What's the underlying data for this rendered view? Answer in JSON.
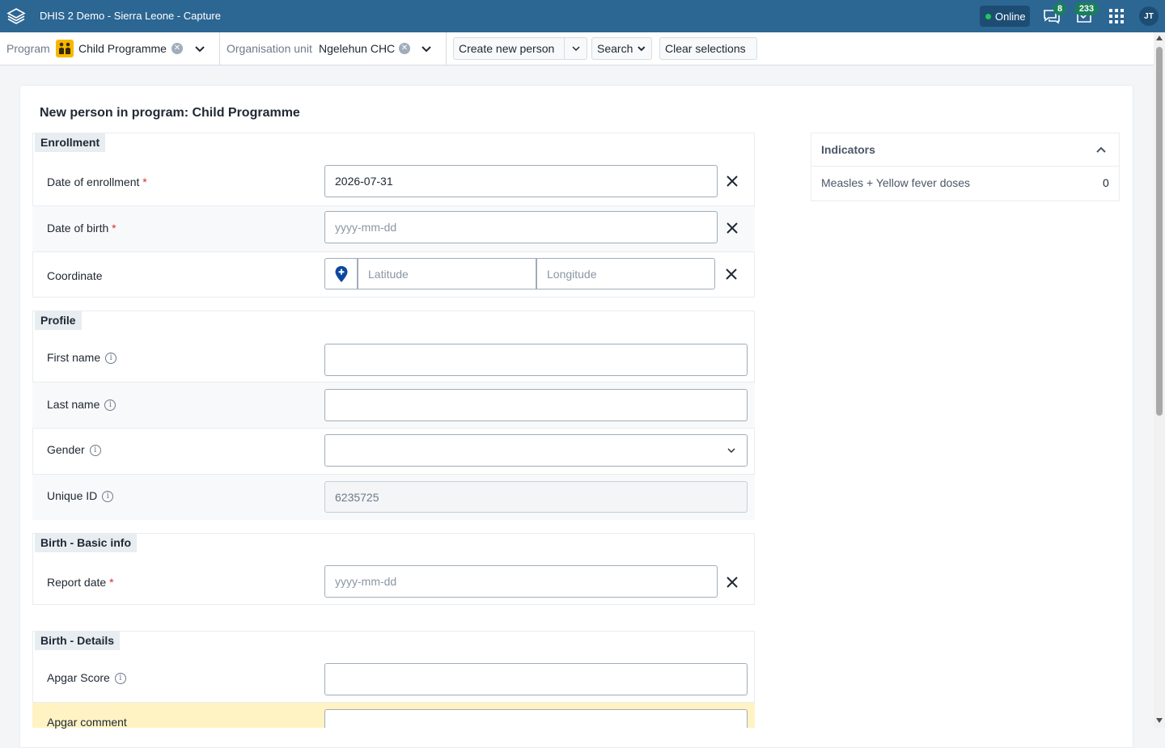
{
  "header": {
    "title": "DHIS 2 Demo - Sierra Leone - Capture",
    "status": "Online",
    "messages_count": "8",
    "interpretations_count": "233",
    "user_initials": "JT"
  },
  "topbar": {
    "program_label": "Program",
    "program_value": "Child Programme",
    "orgunit_label": "Organisation unit",
    "orgunit_value": "Ngelehun CHC",
    "create_new_label": "Create new person",
    "search_label": "Search",
    "clear_selections_label": "Clear selections"
  },
  "form": {
    "title": "New person in program: Child Programme",
    "sections": {
      "enrollment": {
        "title": "Enrollment",
        "date_of_enrollment_label": "Date of enrollment",
        "date_of_enrollment_value": "2026-07-31",
        "date_of_birth_label": "Date of birth",
        "date_of_birth_placeholder": "yyyy-mm-dd",
        "coordinate_label": "Coordinate",
        "latitude_placeholder": "Latitude",
        "longitude_placeholder": "Longitude"
      },
      "profile": {
        "title": "Profile",
        "first_name_label": "First name",
        "last_name_label": "Last name",
        "gender_label": "Gender",
        "unique_id_label": "Unique ID",
        "unique_id_value": "6235725"
      },
      "birth_basic": {
        "title": "Birth - Basic info",
        "report_date_label": "Report date",
        "report_date_placeholder": "yyyy-mm-dd"
      },
      "birth_details": {
        "title": "Birth - Details",
        "apgar_score_label": "Apgar Score",
        "apgar_comment_label": "Apgar comment"
      }
    },
    "required_marker": "*"
  },
  "indicators": {
    "title": "Indicators",
    "items": [
      {
        "label": "Measles + Yellow fever doses",
        "value": "0"
      }
    ]
  },
  "colors": {
    "header_bg": "#2c6693",
    "badge_green": "#1a7f5a",
    "required_red": "#d32f2f",
    "highlight_row": "#fff3c4"
  }
}
